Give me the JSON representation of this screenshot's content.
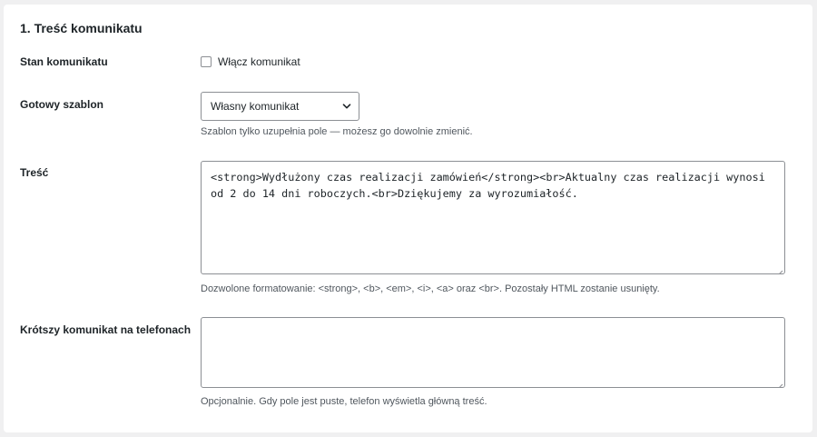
{
  "section": {
    "title": "1. Treść komunikatu"
  },
  "rows": {
    "status": {
      "label": "Stan komunikatu",
      "checkbox_label": "Włącz komunikat",
      "checked": false
    },
    "template": {
      "label": "Gotowy szablon",
      "selected": "Własny komunikat",
      "help": "Szablon tylko uzupełnia pole — możesz go dowolnie zmienić."
    },
    "content": {
      "label": "Treść",
      "value": "<strong>Wydłużony czas realizacji zamówień</strong><br>Aktualny czas realizacji wynosi od 2 do 14 dni roboczych.<br>Dziękujemy za wyrozumiałość.",
      "help": "Dozwolone formatowanie: <strong>, <b>, <em>, <i>, <a> oraz <br>. Pozostały HTML zostanie usunięty."
    },
    "mobile": {
      "label": "Krótszy komunikat na telefonach",
      "value": "",
      "help": "Opcjonalnie. Gdy pole jest puste, telefon wyświetla główną treść."
    }
  },
  "icons": {
    "select_arrow": "chevron-down-icon",
    "resize": "resize-grip-icon"
  },
  "colors": {
    "background": "#f0f0f1",
    "panel": "#ffffff",
    "border": "#8c8f94",
    "text": "#1d2327",
    "help_text": "#50575e"
  }
}
